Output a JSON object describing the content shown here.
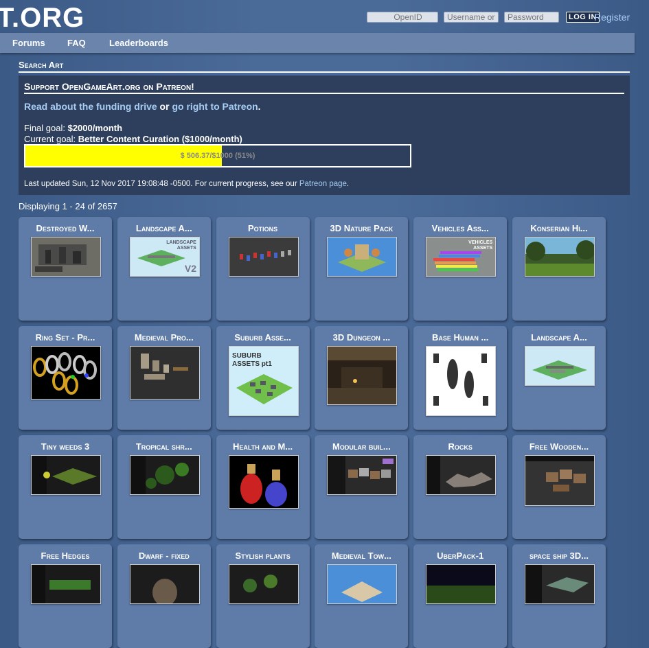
{
  "header": {
    "logo": "T.ORG",
    "openid_placeholder": "OpenID",
    "username_placeholder": "Username or",
    "password_placeholder": "Password",
    "login_label": "LOG IN",
    "register_label": "Register"
  },
  "nav": {
    "items": [
      "Forums",
      "FAQ",
      "Leaderboards"
    ]
  },
  "section_title": "Search Art",
  "patreon": {
    "title": "Support OpenGameArt.org on Patreon!",
    "link1": "Read about the funding drive",
    "or_text": " or ",
    "link2": "go right to Patreon",
    "period": ".",
    "final_goal_label": "Final goal: ",
    "final_goal_value": "$2000/month",
    "current_goal_label": "Current goal: ",
    "current_goal_value": "Better Content Curation ($1000/month)",
    "progress_text": "$ 506.37/$1000 (51%)",
    "progress_fraction": 0.51,
    "updated_text": "Last updated Sun, 12 Nov 2017 19:08:48 -0500. For current progress, see our ",
    "updated_link": "Patreon page",
    "updated_end": "."
  },
  "displaying": "Displaying 1 - 24 of 2657",
  "tiles": [
    {
      "title": "Destroyed W...",
      "thumb": "ruins"
    },
    {
      "title": "Landscape A...",
      "thumb": "landscape-v2",
      "label": "LANDSCAPE ASSETS",
      "extra": "V2"
    },
    {
      "title": "Potions",
      "thumb": "potions"
    },
    {
      "title": "3D Nature Pack",
      "thumb": "nature"
    },
    {
      "title": "Vehicles Ass...",
      "thumb": "vehicles",
      "label": "VEHICLES ASSETS"
    },
    {
      "title": "Konserian Hi...",
      "thumb": "forest"
    },
    {
      "title": "Ring Set - Pr...",
      "thumb": "rings"
    },
    {
      "title": "Medieval Pro...",
      "thumb": "medieval-props"
    },
    {
      "title": "Suburb Asse...",
      "thumb": "suburb",
      "label": "SUBURB ASSETS pt1"
    },
    {
      "title": "3D Dungeon ...",
      "thumb": "dungeon"
    },
    {
      "title": "Base Human ...",
      "thumb": "humans"
    },
    {
      "title": "Landscape A...",
      "thumb": "landscape"
    },
    {
      "title": "Tiny weeds 3",
      "thumb": "weeds"
    },
    {
      "title": "Tropical shr...",
      "thumb": "tropical"
    },
    {
      "title": "Health and M...",
      "thumb": "bottles"
    },
    {
      "title": "Modular buil...",
      "thumb": "modular"
    },
    {
      "title": "Rocks",
      "thumb": "rocks"
    },
    {
      "title": "Free Wooden...",
      "thumb": "wooden"
    },
    {
      "title": "Free Hedges",
      "thumb": "hedges"
    },
    {
      "title": "Dwarf - fixed",
      "thumb": "dwarf"
    },
    {
      "title": "Stylish plants",
      "thumb": "plants"
    },
    {
      "title": "Medieval Tow...",
      "thumb": "town"
    },
    {
      "title": "UberPack-1",
      "thumb": "uberpack"
    },
    {
      "title": "space ship 3D...",
      "thumb": "spaceship"
    }
  ]
}
